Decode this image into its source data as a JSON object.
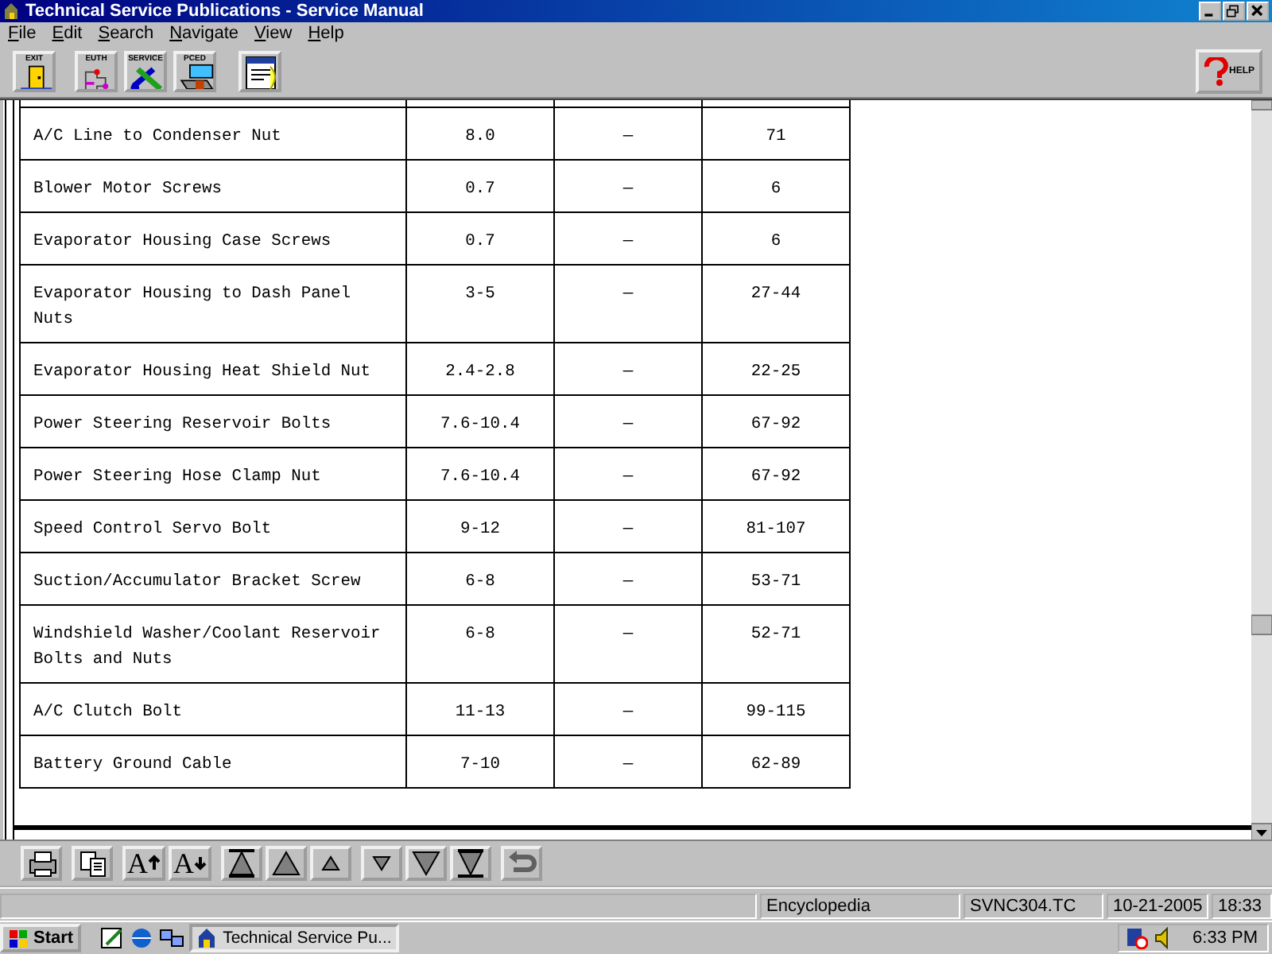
{
  "window": {
    "title": "Technical Service Publications - Service Manual"
  },
  "menu": [
    "File",
    "Edit",
    "Search",
    "Navigate",
    "View",
    "Help"
  ],
  "toolbar": [
    {
      "kind": "exit",
      "label": "EXIT"
    },
    {
      "kind": "euth",
      "label": "EUTH"
    },
    {
      "kind": "service",
      "label": "SERVICE"
    },
    {
      "kind": "pced",
      "label": "PCED"
    },
    {
      "kind": "notes"
    }
  ],
  "help_button": {
    "label": "HELP"
  },
  "table": {
    "rows": [
      [
        "A/C Line to Condenser Nut",
        "8.0",
        "—",
        "71"
      ],
      [
        "Blower Motor Screws",
        "0.7",
        "—",
        "6"
      ],
      [
        "Evaporator Housing Case Screws",
        "0.7",
        "—",
        "6"
      ],
      [
        "Evaporator Housing to Dash Panel Nuts",
        "3-5",
        "—",
        "27-44"
      ],
      [
        "Evaporator Housing Heat Shield Nut",
        "2.4-2.8",
        "—",
        "22-25"
      ],
      [
        "Power Steering Reservoir Bolts",
        "7.6-10.4",
        "—",
        "67-92"
      ],
      [
        "Power Steering Hose Clamp Nut",
        "7.6-10.4",
        "—",
        "67-92"
      ],
      [
        "Speed Control Servo Bolt",
        "9-12",
        "—",
        "81-107"
      ],
      [
        "Suction/Accumulator Bracket Screw",
        "6-8",
        "—",
        "53-71"
      ],
      [
        "Windshield Washer/Coolant Reservoir Bolts and Nuts",
        "6-8",
        "—",
        "52-71"
      ],
      [
        "A/C Clutch Bolt",
        "11-13",
        "—",
        "99-115"
      ],
      [
        "Battery Ground Cable",
        "7-10",
        "—",
        "62-89"
      ]
    ]
  },
  "nav_toolbar": [
    {
      "kind": "print"
    },
    {
      "kind": "copy"
    },
    {
      "kind": "font-up",
      "label": "A"
    },
    {
      "kind": "font-down",
      "label": "A"
    },
    {
      "kind": "first"
    },
    {
      "kind": "page-up"
    },
    {
      "kind": "line-up"
    },
    {
      "kind": "line-down"
    },
    {
      "kind": "page-down"
    },
    {
      "kind": "last"
    },
    {
      "kind": "back"
    }
  ],
  "status_bar": [
    "Encyclopedia",
    "SVNC304.TC",
    "10-21-2005",
    "18:33"
  ],
  "taskbar": {
    "start": "Start",
    "task": "Technical Service Pu...",
    "clock": "6:33 PM"
  }
}
